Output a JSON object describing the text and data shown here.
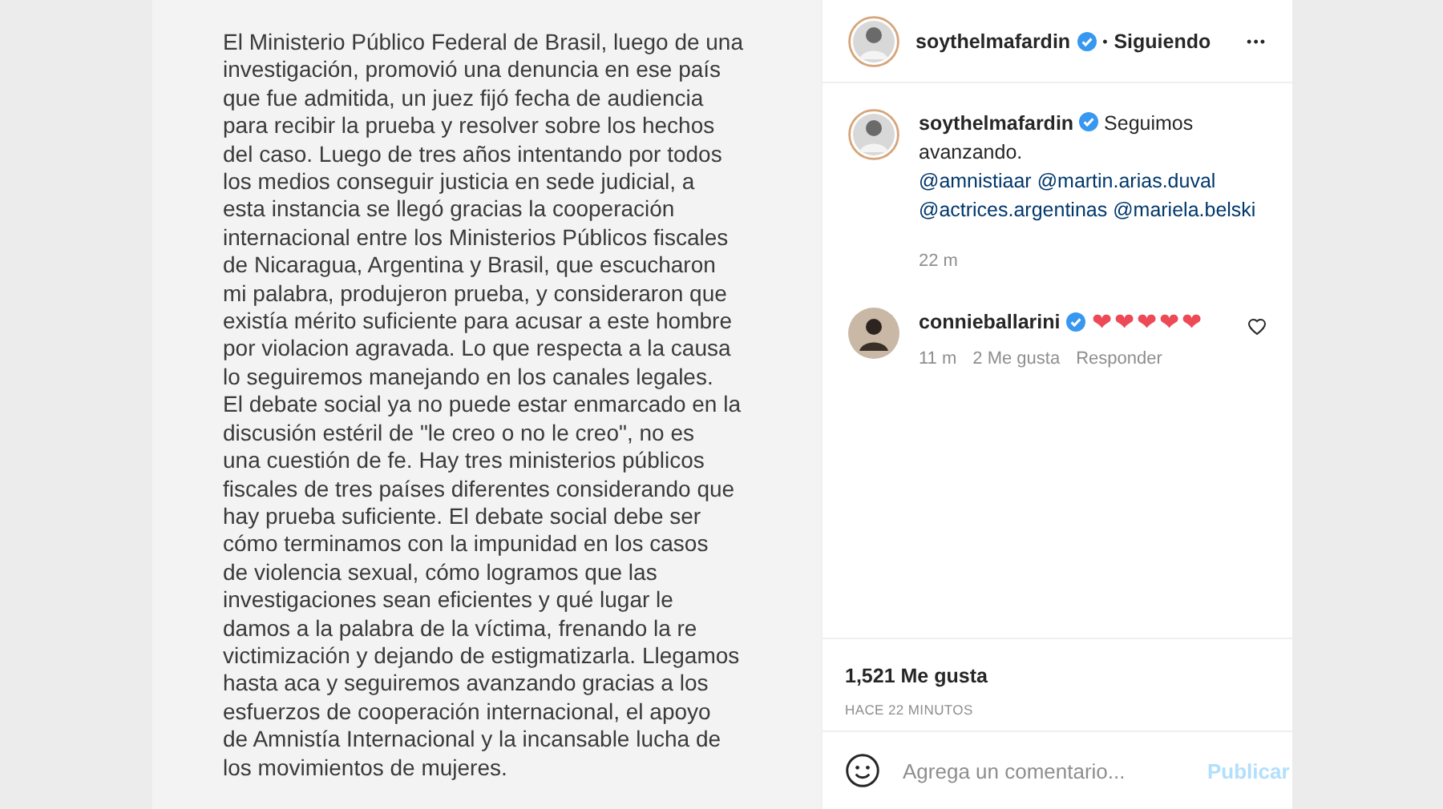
{
  "statement": {
    "lines": [
      "El Ministerio Público Federal de Brasil, luego de una",
      "investigación, promovió una denuncia en ese país",
      "que fue admitida, un juez fijó fecha de audiencia",
      "para recibir la prueba y resolver sobre los hechos",
      "del caso. Luego de tres años intentando por todos",
      "los medios conseguir justicia en sede judicial, a",
      "esta instancia se llegó gracias la cooperación",
      "internacional entre los Ministerios Públicos fiscales",
      "de Nicaragua, Argentina y Brasil, que escucharon",
      "mi palabra, produjeron prueba, y consideraron que",
      "existía mérito suficiente para acusar a este hombre",
      "por violacion agravada. Lo que respecta a la causa",
      "lo seguiremos manejando en los canales legales.",
      "El debate social ya no puede estar enmarcado en la",
      "discusión estéril de \"le creo o no le creo\", no es",
      "una cuestión de fe. Hay tres ministerios públicos",
      "fiscales de tres países diferentes considerando que",
      "hay prueba suficiente. El debate social debe ser",
      "cómo terminamos con la impunidad en los casos",
      "de violencia sexual, cómo logramos que las",
      "investigaciones sean eficientes y qué lugar le",
      "damos a la palabra de la víctima, frenando la re",
      "victimización y dejando de estigmatizarla. Llegamos",
      "hasta aca y seguiremos avanzando gracias a los",
      "esfuerzos de cooperación internacional, el apoyo",
      "de Amnistía Internacional y la incansable lucha de",
      "los movimientos de mujeres."
    ]
  },
  "header": {
    "username": "soythelmafardin",
    "verified": true,
    "separator": "•",
    "follow": "Siguiendo",
    "more": "•••"
  },
  "caption": {
    "username": "soythelmafardin",
    "verified": true,
    "text": "Seguimos avanzando.",
    "mentions": [
      "@amnistiaar",
      "@martin.arias.duval",
      "@actrices.argentinas",
      "@mariela.belski"
    ],
    "time": "22 m"
  },
  "comments": [
    {
      "username": "connieballarini",
      "verified": true,
      "text": "❤❤❤❤❤",
      "time": "11 m",
      "likes": "2 Me gusta",
      "reply": "Responder",
      "liked": false
    }
  ],
  "likes": "1,521 Me gusta",
  "timestamp": "HACE 22 MINUTOS",
  "composer": {
    "placeholder": "Agrega un comentario...",
    "submit": "Publicar",
    "submit_disabled": true
  }
}
